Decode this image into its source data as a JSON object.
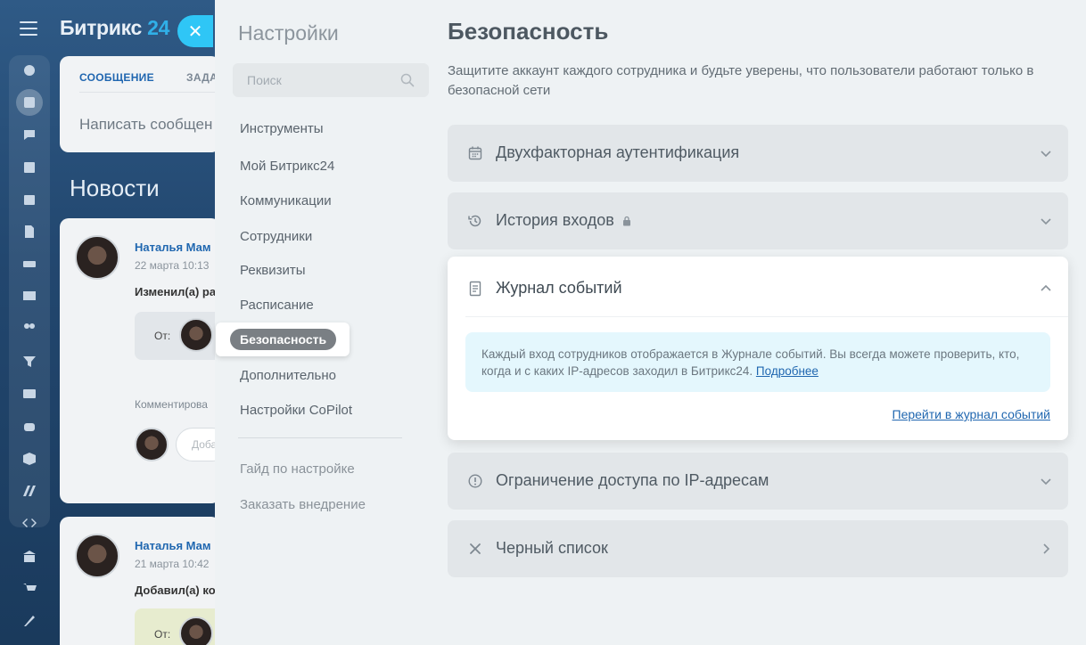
{
  "portal": {
    "logo_text": "Битрикс",
    "logo_num": "24",
    "tabs": [
      "СООБЩЕНИЕ",
      "ЗАДА"
    ],
    "write_placeholder": "Написать сообщен",
    "news_title": "Новости",
    "posts": [
      {
        "author": "Наталья Мам",
        "date": "22 марта 10:13",
        "action": "Изменил(а) ра",
        "from_label": "От:",
        "comment_label": "Комментирова",
        "add_label": "Доба"
      },
      {
        "author": "Наталья Мам",
        "date": "21 марта 10:42",
        "action": "Добавил(а) ко",
        "from_label": "От:"
      }
    ]
  },
  "settings": {
    "title": "Настройки",
    "search_placeholder": "Поиск",
    "nav": [
      "Инструменты",
      "Мой Битрикс24",
      "Коммуникации",
      "Сотрудники",
      "Реквизиты",
      "Расписание",
      "Безопасность",
      "Дополнительно",
      "Настройки CoPilot"
    ],
    "nav_secondary": [
      "Гайд по настройке",
      "Заказать внедрение"
    ],
    "active_item": "Безопасность"
  },
  "security": {
    "title": "Безопасность",
    "description": "Защитите аккаунт каждого сотрудника и будьте уверены, что пользователи работают только в безопасной сети",
    "sections": [
      {
        "title": "Двухфакторная аутентификация",
        "icon": "calendar-icon"
      },
      {
        "title": "История входов",
        "icon": "history-icon",
        "locked": true
      },
      {
        "title": "Журнал событий",
        "icon": "document-icon",
        "expanded": true
      },
      {
        "title": "Ограничение доступа по IP-адресам",
        "icon": "info-circle-icon"
      },
      {
        "title": "Черный список",
        "icon": "cross-icon"
      }
    ],
    "event_log": {
      "info_text": "Каждый вход сотрудников отображается в Журнале событий. Вы всегда можете проверить, кто, когда и с каких IP-адресов заходил в Битрикс24.",
      "more_link": "Подробнее",
      "go_link": "Перейти в журнал событий"
    }
  },
  "colors": {
    "accent": "#2fc6f6",
    "link": "#2067b0",
    "info_bg": "#e4f7fd",
    "highlight_pill": "#7a7f84"
  }
}
